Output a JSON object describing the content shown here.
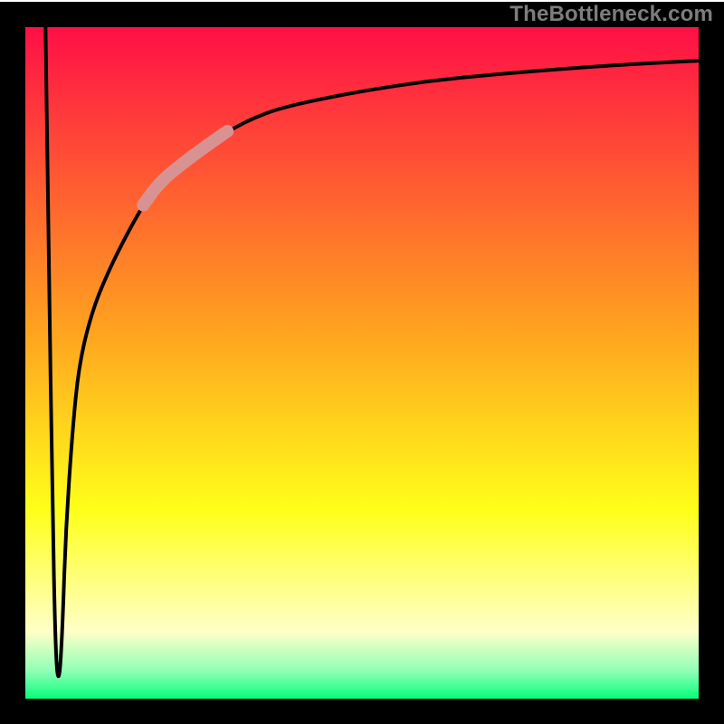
{
  "watermark": "TheBottleneck.com",
  "colors": {
    "red": "#ff0f46",
    "orange": "#ff8b1f",
    "yellow": "#ffff1a",
    "pale": "#ffffc0",
    "green": "#06ff7a",
    "frame": "#000000",
    "curve": "#000000",
    "accent": "#d89292"
  },
  "chart_data": {
    "type": "line",
    "title": "",
    "xlabel": "",
    "ylabel": "",
    "xlim": [
      0,
      100
    ],
    "ylim": [
      0,
      100
    ],
    "grid": false,
    "background_gradient": [
      {
        "pos": 0.0,
        "color": "#ff0f46"
      },
      {
        "pos": 0.45,
        "color": "#ffa21f"
      },
      {
        "pos": 0.72,
        "color": "#ffff1a"
      },
      {
        "pos": 0.9,
        "color": "#ffffc8"
      },
      {
        "pos": 0.96,
        "color": "#8cffb4"
      },
      {
        "pos": 1.0,
        "color": "#06ff7a"
      }
    ],
    "series": [
      {
        "name": "main-curve",
        "x": [
          3.0,
          3.5,
          4.0,
          4.5,
          5.0,
          5.5,
          6.0,
          7.0,
          8.0,
          10.0,
          12.5,
          15.0,
          17.5,
          20.0,
          25.0,
          30.0,
          35.0,
          40.0,
          50.0,
          60.0,
          70.0,
          80.0,
          90.0,
          100.0
        ],
        "y": [
          100.0,
          65.0,
          30.0,
          6.0,
          2.0,
          10.0,
          25.0,
          40.0,
          50.0,
          58.0,
          64.0,
          69.0,
          73.5,
          77.0,
          81.0,
          84.5,
          87.0,
          88.5,
          90.5,
          92.0,
          93.0,
          93.8,
          94.5,
          95.0
        ]
      }
    ],
    "accent_segment": {
      "series": "main-curve",
      "x_start": 17.5,
      "x_end": 30.0
    }
  }
}
